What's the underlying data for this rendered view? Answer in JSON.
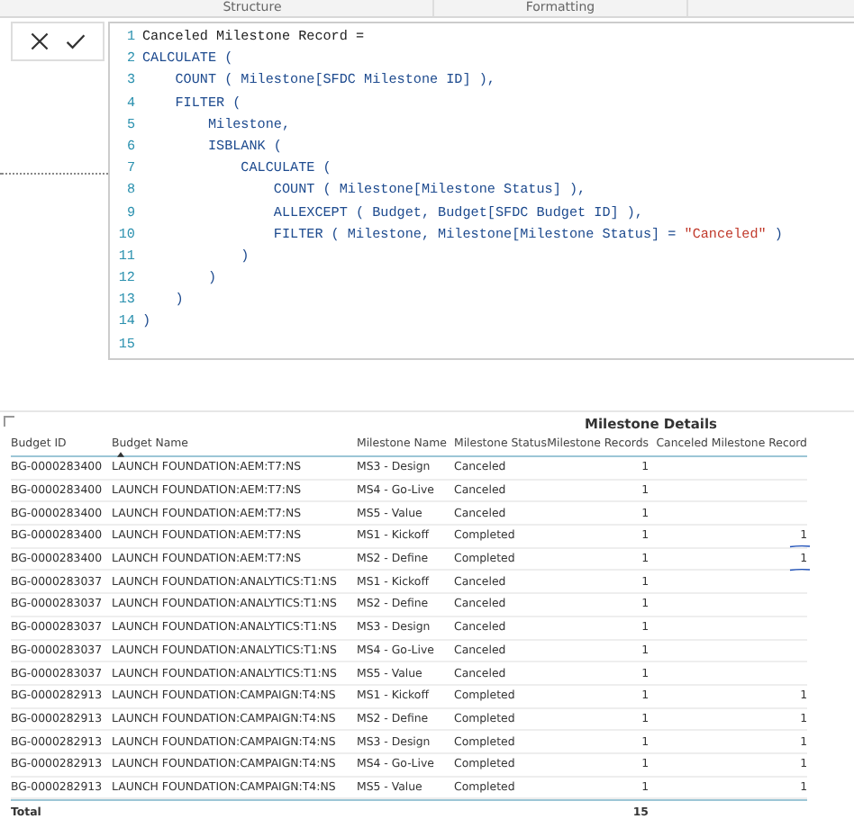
{
  "tabs": [
    {
      "label": "Structure",
      "selected": false
    },
    {
      "label": "Formatting",
      "selected": false
    }
  ],
  "editor": {
    "lines": [
      {
        "number": "1",
        "tokens": [
          {
            "kind": "text",
            "text": "Canceled Milestone Record ="
          }
        ]
      },
      {
        "number": "2",
        "tokens": [
          {
            "kind": "keyword",
            "text": "CALCULATE ("
          }
        ]
      },
      {
        "number": "3",
        "tokens": [
          {
            "kind": "keyword",
            "text": "    COUNT ( Milestone[SFDC Milestone ID] ),"
          }
        ]
      },
      {
        "number": "4",
        "tokens": [
          {
            "kind": "keyword",
            "text": "    FILTER ("
          }
        ]
      },
      {
        "number": "5",
        "tokens": [
          {
            "kind": "keyword",
            "text": "        Milestone,"
          }
        ]
      },
      {
        "number": "6",
        "tokens": [
          {
            "kind": "keyword",
            "text": "        ISBLANK ("
          }
        ]
      },
      {
        "number": "7",
        "tokens": [
          {
            "kind": "keyword",
            "text": "            CALCULATE ("
          }
        ]
      },
      {
        "number": "8",
        "tokens": [
          {
            "kind": "keyword",
            "text": "                COUNT ( Milestone[Milestone Status] ),"
          }
        ]
      },
      {
        "number": "9",
        "tokens": [
          {
            "kind": "keyword",
            "text": "                ALLEXCEPT ( Budget, Budget[SFDC Budget ID] ),"
          }
        ]
      },
      {
        "number": "10",
        "tokens": [
          {
            "kind": "keyword",
            "text": "                FILTER ( Milestone, Milestone[Milestone Status] = "
          },
          {
            "kind": "string",
            "text": "\"Canceled\""
          },
          {
            "kind": "keyword",
            "text": " )"
          }
        ]
      },
      {
        "number": "11",
        "tokens": [
          {
            "kind": "keyword",
            "text": "            )"
          }
        ]
      },
      {
        "number": "12",
        "tokens": [
          {
            "kind": "keyword",
            "text": "        )"
          }
        ]
      },
      {
        "number": "13",
        "tokens": [
          {
            "kind": "keyword",
            "text": "    )"
          }
        ]
      },
      {
        "number": "14",
        "tokens": [
          {
            "kind": "keyword",
            "text": ")"
          }
        ]
      },
      {
        "number": "15"
      }
    ]
  },
  "table": {
    "title": "Milestone Details",
    "columns": [
      "Budget ID",
      "Budget Name",
      "Milestone Name",
      "Milestone Status",
      "Milestone Records",
      "Canceled Milestone Record"
    ],
    "rows": [
      {
        "cells": [
          "BG-0000283400",
          "LAUNCH FOUNDATION:AEM:T7:NS",
          "MS3 - Design",
          "Canceled",
          "1",
          ""
        ],
        "underlined": false
      },
      {
        "cells": [
          "BG-0000283400",
          "LAUNCH FOUNDATION:AEM:T7:NS",
          "MS4 - Go-Live",
          "Canceled",
          "1",
          ""
        ],
        "underlined": false
      },
      {
        "cells": [
          "BG-0000283400",
          "LAUNCH FOUNDATION:AEM:T7:NS",
          "MS5 - Value",
          "Canceled",
          "1",
          ""
        ],
        "underlined": false
      },
      {
        "cells": [
          "BG-0000283400",
          "LAUNCH FOUNDATION:AEM:T7:NS",
          "MS1 - Kickoff",
          "Completed",
          "1",
          "1"
        ],
        "underlined": true
      },
      {
        "cells": [
          "BG-0000283400",
          "LAUNCH FOUNDATION:AEM:T7:NS",
          "MS2 - Define",
          "Completed",
          "1",
          "1"
        ],
        "underlined": true
      },
      {
        "cells": [
          "BG-0000283037",
          "LAUNCH FOUNDATION:ANALYTICS:T1:NS",
          "MS1 - Kickoff",
          "Canceled",
          "1",
          ""
        ],
        "underlined": false
      },
      {
        "cells": [
          "BG-0000283037",
          "LAUNCH FOUNDATION:ANALYTICS:T1:NS",
          "MS2 - Define",
          "Canceled",
          "1",
          ""
        ],
        "underlined": false
      },
      {
        "cells": [
          "BG-0000283037",
          "LAUNCH FOUNDATION:ANALYTICS:T1:NS",
          "MS3 - Design",
          "Canceled",
          "1",
          ""
        ],
        "underlined": false
      },
      {
        "cells": [
          "BG-0000283037",
          "LAUNCH FOUNDATION:ANALYTICS:T1:NS",
          "MS4 - Go-Live",
          "Canceled",
          "1",
          ""
        ],
        "underlined": false
      },
      {
        "cells": [
          "BG-0000283037",
          "LAUNCH FOUNDATION:ANALYTICS:T1:NS",
          "MS5 - Value",
          "Canceled",
          "1",
          ""
        ],
        "underlined": false
      },
      {
        "cells": [
          "BG-0000282913",
          "LAUNCH FOUNDATION:CAMPAIGN:T4:NS",
          "MS1 - Kickoff",
          "Completed",
          "1",
          "1"
        ],
        "underlined": false
      },
      {
        "cells": [
          "BG-0000282913",
          "LAUNCH FOUNDATION:CAMPAIGN:T4:NS",
          "MS2 - Define",
          "Completed",
          "1",
          "1"
        ],
        "underlined": false
      },
      {
        "cells": [
          "BG-0000282913",
          "LAUNCH FOUNDATION:CAMPAIGN:T4:NS",
          "MS3 - Design",
          "Completed",
          "1",
          "1"
        ],
        "underlined": false
      },
      {
        "cells": [
          "BG-0000282913",
          "LAUNCH FOUNDATION:CAMPAIGN:T4:NS",
          "MS4 - Go-Live",
          "Completed",
          "1",
          "1"
        ],
        "underlined": false
      },
      {
        "cells": [
          "BG-0000282913",
          "LAUNCH FOUNDATION:CAMPAIGN:T4:NS",
          "MS5 - Value",
          "Completed",
          "1",
          "1"
        ],
        "underlined": false
      }
    ],
    "total": {
      "label": "Total",
      "cells": [
        "",
        "",
        "",
        "",
        "15",
        ""
      ]
    }
  }
}
